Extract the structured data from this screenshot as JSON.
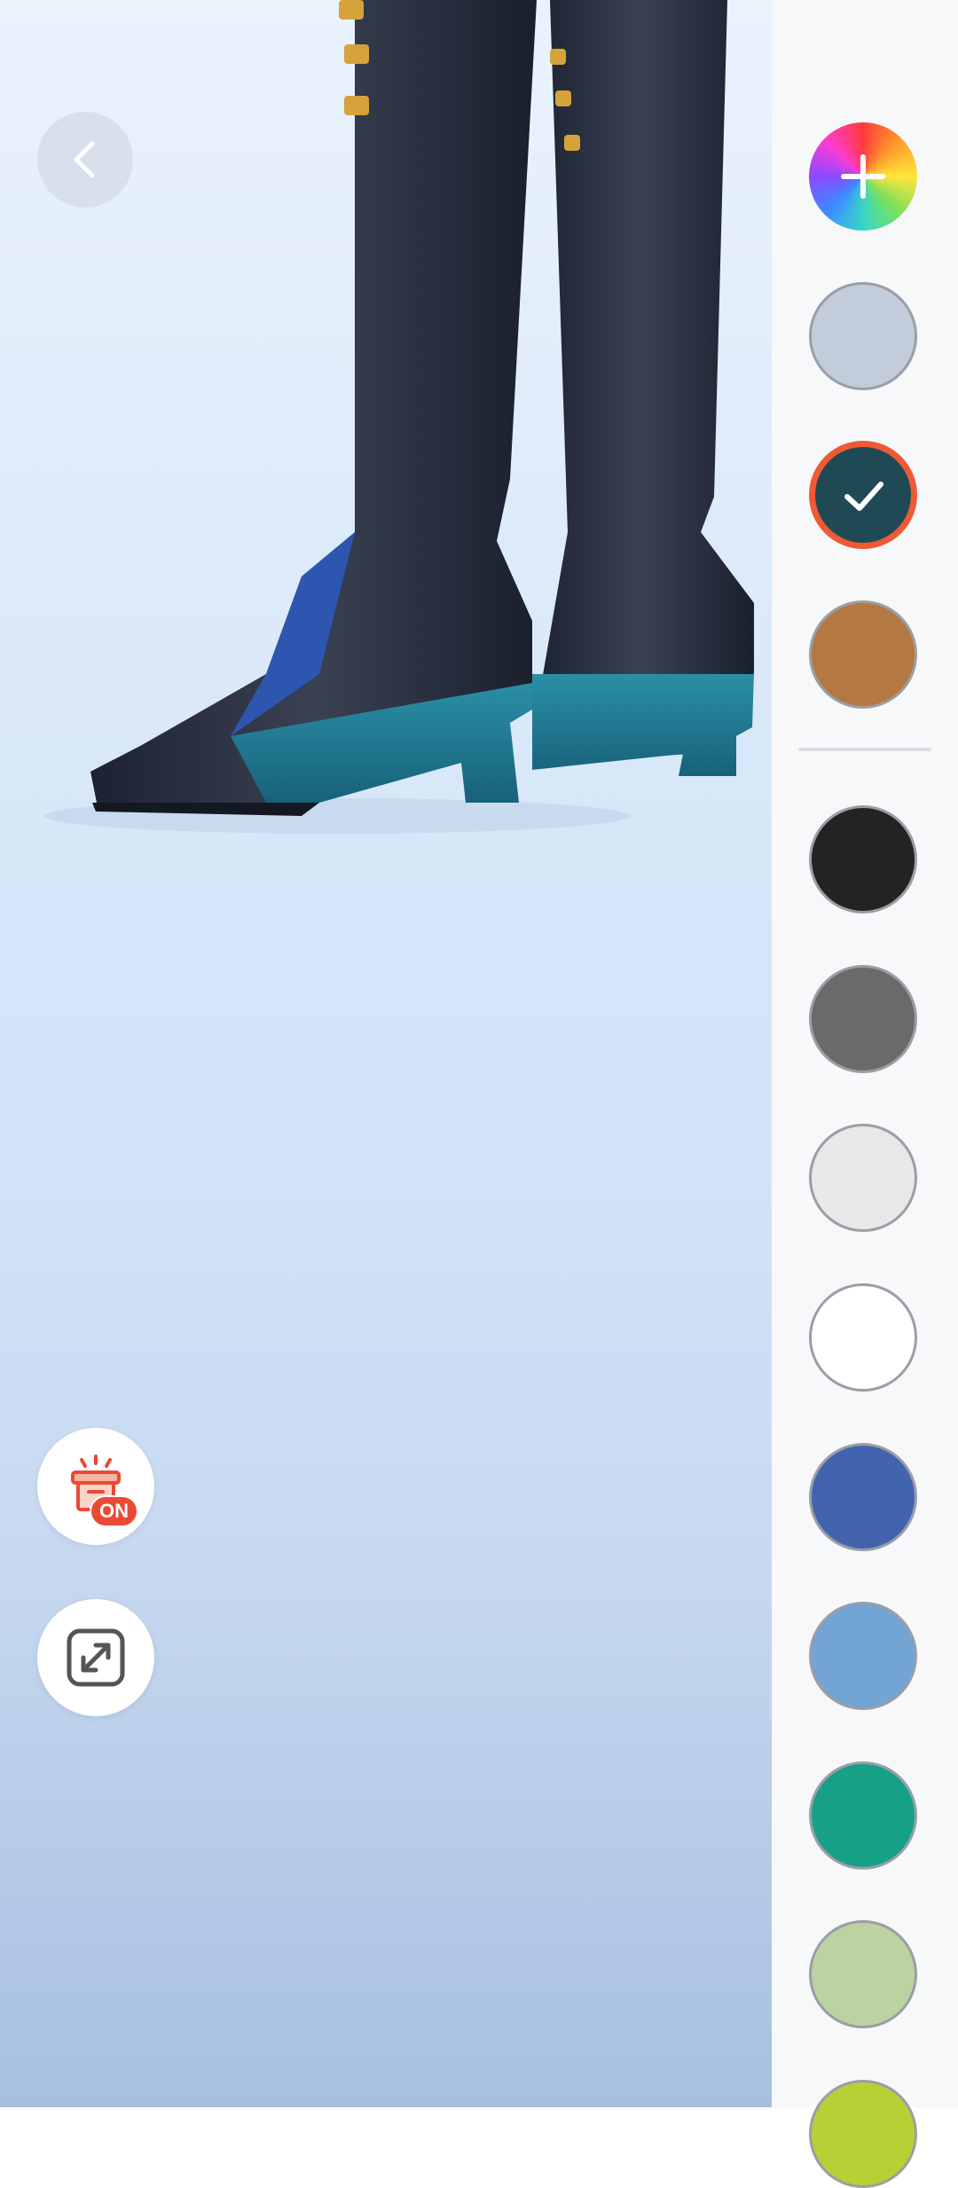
{
  "scene": {
    "description_icon": "boots-3d-preview"
  },
  "floating_buttons": {
    "gift_badge": "ON"
  },
  "palette": {
    "swatches_top": [
      {
        "name": "add-color",
        "color": "rainbow"
      },
      {
        "name": "swatch-light-blue-gray",
        "color": "#c2cddc"
      },
      {
        "name": "swatch-dark-teal",
        "color": "#1f4a55",
        "selected": true
      },
      {
        "name": "swatch-brown",
        "color": "#b47842"
      }
    ],
    "swatches_bottom": [
      {
        "name": "swatch-black",
        "color": "#232323"
      },
      {
        "name": "swatch-gray",
        "color": "#6a6a6a"
      },
      {
        "name": "swatch-light-gray",
        "color": "#e8e8e8"
      },
      {
        "name": "swatch-white",
        "color": "#ffffff"
      },
      {
        "name": "swatch-blue",
        "color": "#4264ae"
      },
      {
        "name": "swatch-sky-blue",
        "color": "#72a4d4"
      },
      {
        "name": "swatch-teal-green",
        "color": "#16a088"
      },
      {
        "name": "swatch-sage-green",
        "color": "#bcd2a0"
      },
      {
        "name": "swatch-lime",
        "color": "#b8cf35"
      }
    ],
    "selected_border_color": "#ef5a35"
  }
}
